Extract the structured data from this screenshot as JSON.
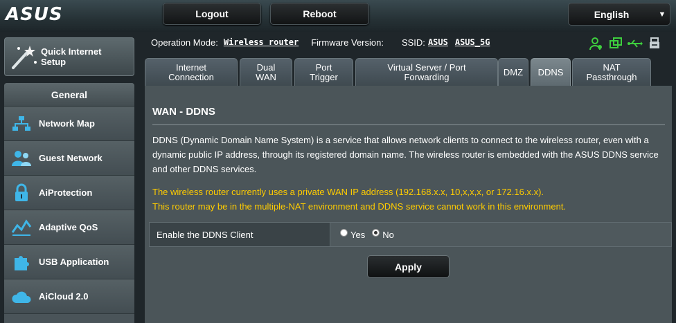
{
  "header": {
    "logo_text": "ASUS",
    "logout_label": "Logout",
    "reboot_label": "Reboot",
    "language": "English"
  },
  "quick_setup": {
    "line1": "Quick Internet",
    "line2": "Setup"
  },
  "sidebar": {
    "section_title": "General",
    "items": [
      {
        "label": "Network Map",
        "icon": "network-map-icon"
      },
      {
        "label": "Guest Network",
        "icon": "guest-network-icon"
      },
      {
        "label": "AiProtection",
        "icon": "lock-icon"
      },
      {
        "label": "Adaptive QoS",
        "icon": "qos-icon"
      },
      {
        "label": "USB Application",
        "icon": "puzzle-icon"
      },
      {
        "label": "AiCloud 2.0",
        "icon": "cloud-icon"
      }
    ]
  },
  "info": {
    "operation_mode_label": "Operation Mode:",
    "operation_mode_value": "Wireless router",
    "firmware_label": "Firmware Version:",
    "ssid_label": "SSID:",
    "ssid_1": "ASUS",
    "ssid_2": "ASUS_5G"
  },
  "tabs": [
    {
      "line1": "Internet",
      "line2": "Connection"
    },
    {
      "line1": "Dual",
      "line2": "WAN"
    },
    {
      "line1": "Port",
      "line2": "Trigger"
    },
    {
      "line1": "Virtual Server / Port",
      "line2": "Forwarding"
    },
    {
      "line1": "DMZ",
      "line2": ""
    },
    {
      "line1": "DDNS",
      "line2": ""
    },
    {
      "line1": "NAT",
      "line2": "Passthrough"
    }
  ],
  "page": {
    "title": "WAN - DDNS",
    "description": "DDNS (Dynamic Domain Name System) is a service that allows network clients to connect to the wireless router, even with a dynamic public IP address, through its registered domain name. The wireless router is embedded with the ASUS DDNS service and other DDNS services.",
    "warning_line1": "The wireless router currently uses a private WAN IP address (192.168.x.x, 10,x,x,x, or 172.16.x.x).",
    "warning_line2": "This router may be in the multiple-NAT environment and DDNS service cannot work in this environment.",
    "field_label": "Enable the DDNS Client",
    "option_yes": "Yes",
    "option_no": "No",
    "selected": "No",
    "apply_label": "Apply"
  },
  "colors": {
    "warning": "#ffcc00",
    "status_icon": "#3ecf3e"
  }
}
